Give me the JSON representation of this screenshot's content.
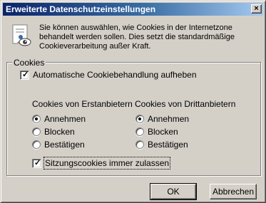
{
  "window": {
    "title": "Erweiterte Datenschutzeinstellungen",
    "close_glyph": "×"
  },
  "intro": {
    "text": "Sie können auswählen, wie Cookies in der Internetzone behandelt werden sollen. Dies setzt die standardmäßige Cookieverarbeitung außer Kraft.",
    "icon": "privacy-settings-icon"
  },
  "cookies_group": {
    "legend": "Cookies",
    "override_label": "Automatische Cookiebehandlung aufheben",
    "override_checked": true,
    "first_party": {
      "header": "Cookies von Erstanbietern",
      "options": [
        "Annehmen",
        "Blocken",
        "Bestätigen"
      ],
      "selected": "Annehmen"
    },
    "third_party": {
      "header": "Cookies von Drittanbietern",
      "options": [
        "Annehmen",
        "Blocken",
        "Bestätigen"
      ],
      "selected": "Annehmen"
    },
    "session_label": "Sitzungscookies immer zulassen",
    "session_checked": true
  },
  "buttons": {
    "ok": "OK",
    "cancel": "Abbrechen"
  },
  "colors": {
    "dialog_face": "#d4d0c8",
    "titlebar_start": "#0a246a",
    "titlebar_end": "#a6caf0"
  }
}
